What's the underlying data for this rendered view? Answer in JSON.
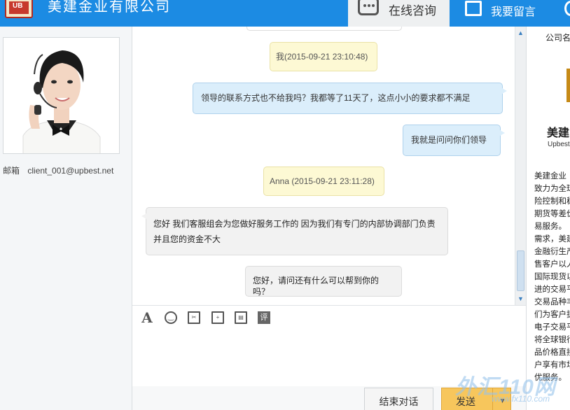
{
  "header": {
    "logo_text": "UB",
    "company_name": "美建金业有限公司",
    "tabs": [
      {
        "label": "在线咨询",
        "icon": "chat-bubble-icon",
        "active": true
      },
      {
        "label": "我要留言",
        "icon": "edit-note-icon",
        "active": false
      }
    ],
    "accent_color": "#1c8be3"
  },
  "agent": {
    "email_label": "邮箱",
    "email_value": "client_001@upbest.net"
  },
  "messages": [
    {
      "type": "time",
      "text": "我(2015-09-21 23:10:48)"
    },
    {
      "type": "me",
      "text": "领导的联系方式也不给我吗？我都等了11天了，这点小小的要求都不满足"
    },
    {
      "type": "me",
      "text": "我就是问问你们领导"
    },
    {
      "type": "time",
      "text": "Anna (2015-09-21 23:11:28)"
    },
    {
      "type": "them",
      "text_line1": "您好  我们客服组会为您做好服务工作的  因为我们有专门的内部协调部门负责",
      "text_line2": "并且您的资金不大"
    },
    {
      "type": "them",
      "text": "您好，请问还有什么可以帮到你的吗？"
    }
  ],
  "toolbar": {
    "tools": [
      {
        "name": "font-icon",
        "glyph": "A"
      },
      {
        "name": "emoji-icon",
        "glyph": "‿"
      },
      {
        "name": "screenshot-icon",
        "glyph": "✂"
      },
      {
        "name": "file-upload-icon",
        "glyph": "+"
      },
      {
        "name": "save-icon",
        "glyph": "▤"
      },
      {
        "name": "rate-icon",
        "glyph": "评"
      }
    ]
  },
  "buttons": {
    "end_chat": "结束对话",
    "send": "发送",
    "send_caret": "▼"
  },
  "right_panel": {
    "title": "公司名",
    "logo_cn": "美建",
    "logo_en": "Upbest",
    "lines": [
      "美建金业",
      "致力为全球",
      "险控制和稳",
      "期货等差价",
      "易服务。",
      "需求，美建",
      "金融衍生产",
      "售客户以人",
      "国际现货以",
      "进的交易平",
      "交易品种丰",
      "们为客户提",
      "电子交易平",
      "将全球银行",
      "品价格直接",
      "户享有市场",
      "优服务。"
    ]
  },
  "watermark": {
    "main": "外汇110网",
    "sub": "www.fx110.com"
  }
}
